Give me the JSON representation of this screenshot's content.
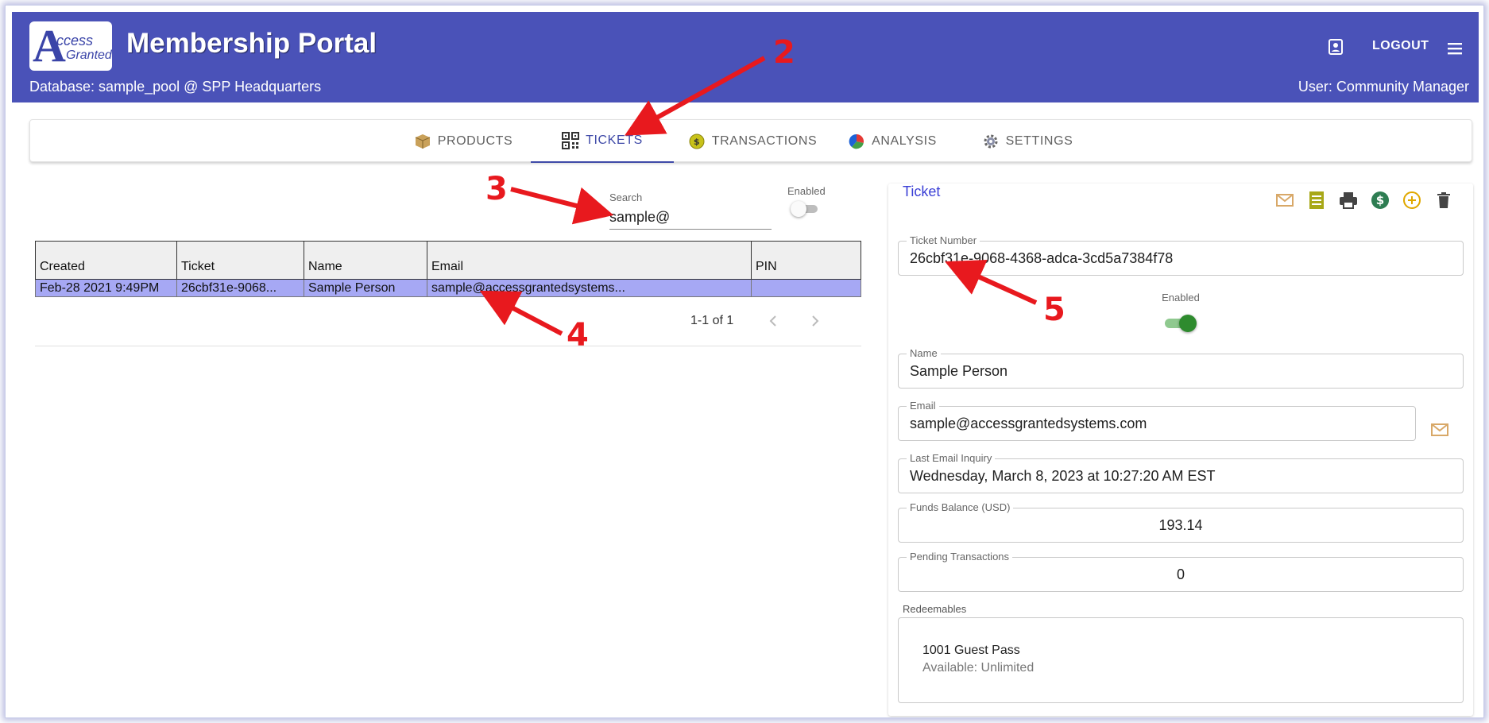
{
  "header": {
    "logo_letter": "A",
    "logo_text_1": "ccess",
    "logo_text_2": "Granted",
    "title": "Membership Portal",
    "database": "Database: sample_pool @ SPP Headquarters",
    "user": "User: Community Manager",
    "logout_label": "LOGOUT"
  },
  "tabs": [
    {
      "label": "PRODUCTS",
      "icon": "package-icon",
      "active": false
    },
    {
      "label": "TICKETS",
      "icon": "qr-code-icon",
      "active": true
    },
    {
      "label": "TRANSACTIONS",
      "icon": "coin-icon",
      "active": false
    },
    {
      "label": "ANALYSIS",
      "icon": "pie-chart-icon",
      "active": false
    },
    {
      "label": "SETTINGS",
      "icon": "gear-icon",
      "active": false
    }
  ],
  "search": {
    "label": "Search",
    "value": "sample@",
    "enabled_label": "Enabled",
    "enabled": false
  },
  "table": {
    "columns": [
      "Created",
      "Ticket",
      "Name",
      "Email",
      "PIN"
    ],
    "rows": [
      [
        "Feb-28 2021 9:49PM",
        "26cbf31e-9068...",
        "Sample Person",
        "sample@accessgrantedsystems...",
        ""
      ]
    ],
    "pagination": "1-1 of 1"
  },
  "detail": {
    "title": "Ticket",
    "ticket_number_label": "Ticket Number",
    "ticket_number": "26cbf31e-9068-4368-adca-3cd5a7384f78",
    "enabled_label": "Enabled",
    "enabled": true,
    "name_label": "Name",
    "name": "Sample Person",
    "email_label": "Email",
    "email": "sample@accessgrantedsystems.com",
    "last_inquiry_label": "Last Email Inquiry",
    "last_inquiry": "Wednesday, March 8, 2023 at 10:27:20 AM EST",
    "funds_label": "Funds Balance (USD)",
    "funds": "193.14",
    "pending_label": "Pending Transactions",
    "pending": "0",
    "redeemables_label": "Redeemables",
    "redeemables": [
      {
        "name": "1001 Guest Pass",
        "available": "Available: Unlimited"
      }
    ]
  },
  "annotations": [
    "2",
    "3",
    "4",
    "5"
  ],
  "colors": {
    "appbar": "#4a52b8",
    "tab_active": "#3f4aa8",
    "row_selected": "#a6a8f4",
    "annotation": "#e8191e",
    "switch_on": "#2e8b2e"
  }
}
